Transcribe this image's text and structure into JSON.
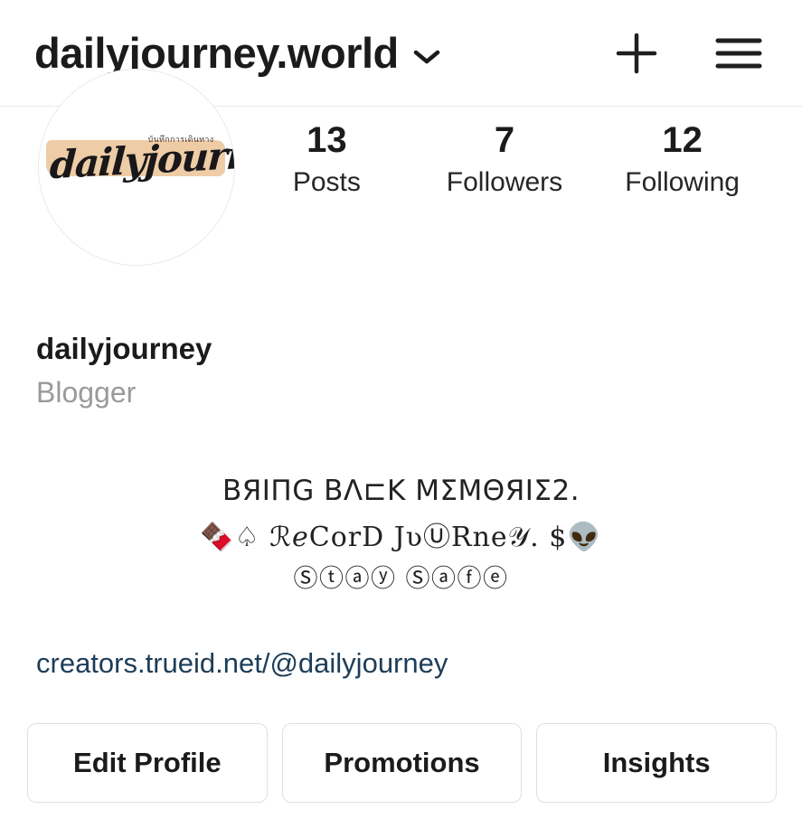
{
  "header": {
    "username": "dailyjourney.world",
    "chevron_icon": "chevron-down-icon",
    "add_icon": "plus-icon",
    "menu_icon": "hamburger-menu-icon"
  },
  "avatar": {
    "script_text": "dailyjourney",
    "thai_text": "บันทึกการเดินทาง",
    "brush_color": "#edcca6"
  },
  "stats": [
    {
      "value": "13",
      "label": "Posts",
      "name": "posts"
    },
    {
      "value": "7",
      "label": "Followers",
      "name": "followers"
    },
    {
      "value": "12",
      "label": "Following",
      "name": "following"
    }
  ],
  "profile": {
    "display_name": "dailyjourney",
    "category": "Blogger"
  },
  "bio": {
    "line1": "ΒЯIΠG ΒΛ⊏K ΜΣΜΘЯIΣ2.",
    "line2": "🍫♤ ℛℯCorD JʋⓊRne𝒴. $👽",
    "line3": "Ⓢⓣⓐⓨ Ⓢⓐⓕⓔ"
  },
  "link": {
    "text": "creators.trueid.net/@dailyjourney",
    "color": "#1d3d58"
  },
  "actions": [
    {
      "label": "Edit Profile",
      "name": "edit-profile"
    },
    {
      "label": "Promotions",
      "name": "promotions"
    },
    {
      "label": "Insights",
      "name": "insights"
    }
  ]
}
